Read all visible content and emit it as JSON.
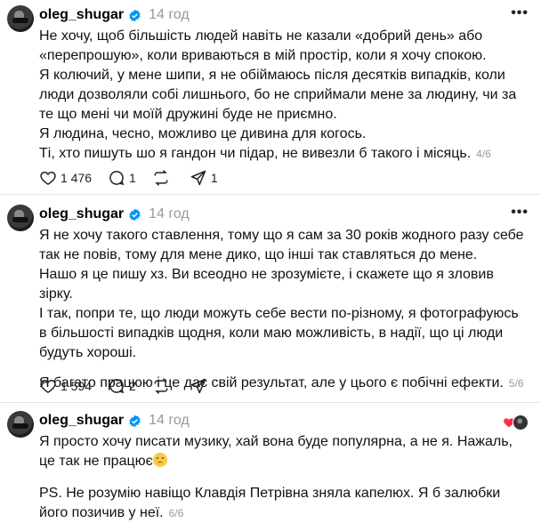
{
  "posts": [
    {
      "username": "oleg_shugar",
      "time": "14 год",
      "lines": [
        "Не хочу, щоб більшість людей навіть не казали «добрий день» або «перепрошую», коли вриваються в мій простір, коли я хочу спокою.",
        "Я колючий, у мене шипи, я не обіймаюсь після десятків випадків, коли люди дозволяли собі лишнього, бо не сприймали мене за людину, чи за те що мені чи моїй дружині буде не приємно.",
        "Я людина, чесно, можливо це дивина для когось.",
        "Ті, хто пишуть шо я гандон чи підар, не вивезли б такого і місяць."
      ],
      "pager": "4/6",
      "likes": "1 476",
      "replies": "1",
      "reposts": "",
      "shares": "1"
    },
    {
      "username": "oleg_shugar",
      "time": "14 год",
      "lines": [
        "Я не хочу такого ставлення, тому що я сам за 30 років жодного разу себе так не повів, тому для мене дико, що інші так ставляться до мене.",
        "Нашо я це пишу хз. Ви всеодно не зрозумієте, і скажете що я зловив зірку.",
        "І так, попри те, що люди можуть себе вести по-різному, я фотографуюсь в більшості випадків щодня, коли маю можливість, в надії, що ці люди будуть хороші.",
        "Я багато працюю і це дає свій результат, але у цього є побічні ефекти."
      ],
      "pager": "5/6",
      "likes": "1 594",
      "replies": "2",
      "reposts": "",
      "shares": ""
    },
    {
      "username": "oleg_shugar",
      "time": "14 год",
      "lines": [
        "Я просто хочу писати музику, хай вона буде популярна, а не я. Нажаль, це так не працює",
        "PS. Не розумію навіщо Клавдія Петрівна зняла капелюх. Я б залюбки його позичив у неї."
      ],
      "pager": "6/6"
    }
  ],
  "colors": {
    "verified": "#0095f6",
    "liked_heart": "#ff3040"
  }
}
